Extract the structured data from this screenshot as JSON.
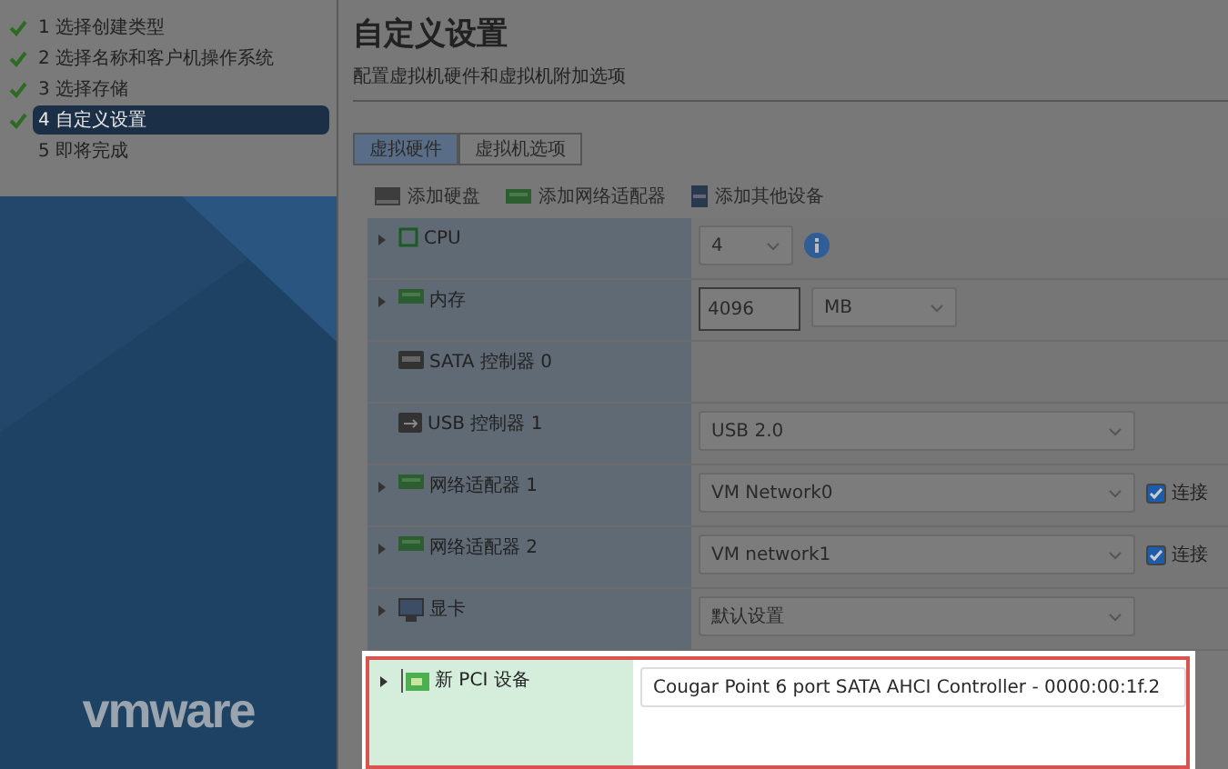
{
  "steps": [
    {
      "label": "1 选择创建类型",
      "done": true,
      "selected": false
    },
    {
      "label": "2 选择名称和客户机操作系统",
      "done": true,
      "selected": false
    },
    {
      "label": "3 选择存储",
      "done": true,
      "selected": false
    },
    {
      "label": "4 自定义设置",
      "done": true,
      "selected": true
    },
    {
      "label": "5 即将完成",
      "done": false,
      "selected": false
    }
  ],
  "brand": "vmware",
  "title": "自定义设置",
  "subtitle": "配置虚拟机硬件和虚拟机附加选项",
  "tabs": [
    {
      "label": "虚拟硬件",
      "selected": true
    },
    {
      "label": "虚拟机选项",
      "selected": false
    }
  ],
  "toolbar": [
    {
      "label": "添加硬盘",
      "kind": "disk"
    },
    {
      "label": "添加网络适配器",
      "kind": "nic"
    },
    {
      "label": "添加其他设备",
      "kind": "device"
    }
  ],
  "devices": [
    {
      "name": "CPU",
      "expandable": true,
      "highlighted": false,
      "kind": "select",
      "value": "4",
      "info": true
    },
    {
      "name": "内存",
      "expandable": true,
      "highlighted": false,
      "kind": "memory",
      "value": "4096",
      "unit": "MB"
    },
    {
      "name": "SATA 控制器 0",
      "expandable": false,
      "highlighted": false,
      "kind": "empty"
    },
    {
      "name": "USB 控制器 1",
      "expandable": false,
      "highlighted": false,
      "kind": "select",
      "value": "USB 2.0"
    },
    {
      "name": "网络适配器 1",
      "expandable": true,
      "highlighted": false,
      "kind": "select",
      "value": "VM Network0",
      "connect": {
        "label": "连接",
        "checked": true
      }
    },
    {
      "name": "网络适配器 2",
      "expandable": true,
      "highlighted": false,
      "kind": "select",
      "value": "VM network1",
      "connect": {
        "label": "连接",
        "checked": true
      }
    },
    {
      "name": "显卡",
      "expandable": true,
      "highlighted": false,
      "kind": "select",
      "value": "默认设置"
    },
    {
      "name": "新 PCI 设备",
      "expandable": true,
      "highlighted": true,
      "kind": "text",
      "value": "Cougar Point 6 port SATA AHCI Controller - 0000:00:1f.2"
    }
  ]
}
